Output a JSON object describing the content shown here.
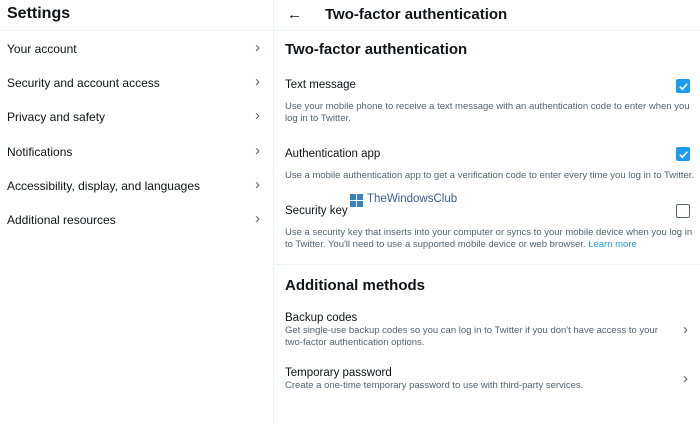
{
  "sidebar": {
    "title": "Settings",
    "items": [
      {
        "label": "Your account"
      },
      {
        "label": "Security and account access"
      },
      {
        "label": "Privacy and safety"
      },
      {
        "label": "Notifications"
      },
      {
        "label": "Accessibility, display, and languages"
      },
      {
        "label": "Additional resources"
      }
    ]
  },
  "header": {
    "title": "Two-factor authentication"
  },
  "main": {
    "section_title": "Two-factor authentication",
    "options": [
      {
        "title": "Text message",
        "description": "Use your mobile phone to receive a text message with an authentication code to enter when you log in to Twitter.",
        "checked": true
      },
      {
        "title": "Authentication app",
        "description": "Use a mobile authentication app to get a verification code to enter every time you log in to Twitter.",
        "checked": true
      },
      {
        "title": "Security key",
        "description": "Use a security key that inserts into your computer or syncs to your mobile device when you log in to Twitter. You'll need to use a supported mobile device or web browser.",
        "link": "Learn more",
        "checked": false
      }
    ],
    "additional_title": "Additional methods",
    "methods": [
      {
        "title": "Backup codes",
        "description": "Get single-use backup codes so you can log in to Twitter if you don't have access to your two-factor authentication options."
      },
      {
        "title": "Temporary password",
        "description": "Create a one-time temporary password to use with third-party services."
      }
    ]
  },
  "watermark": {
    "text": "TheWindowsClub"
  },
  "colors": {
    "accent": "#1d9bf0",
    "text": "#0f1419",
    "secondary": "#536471"
  }
}
